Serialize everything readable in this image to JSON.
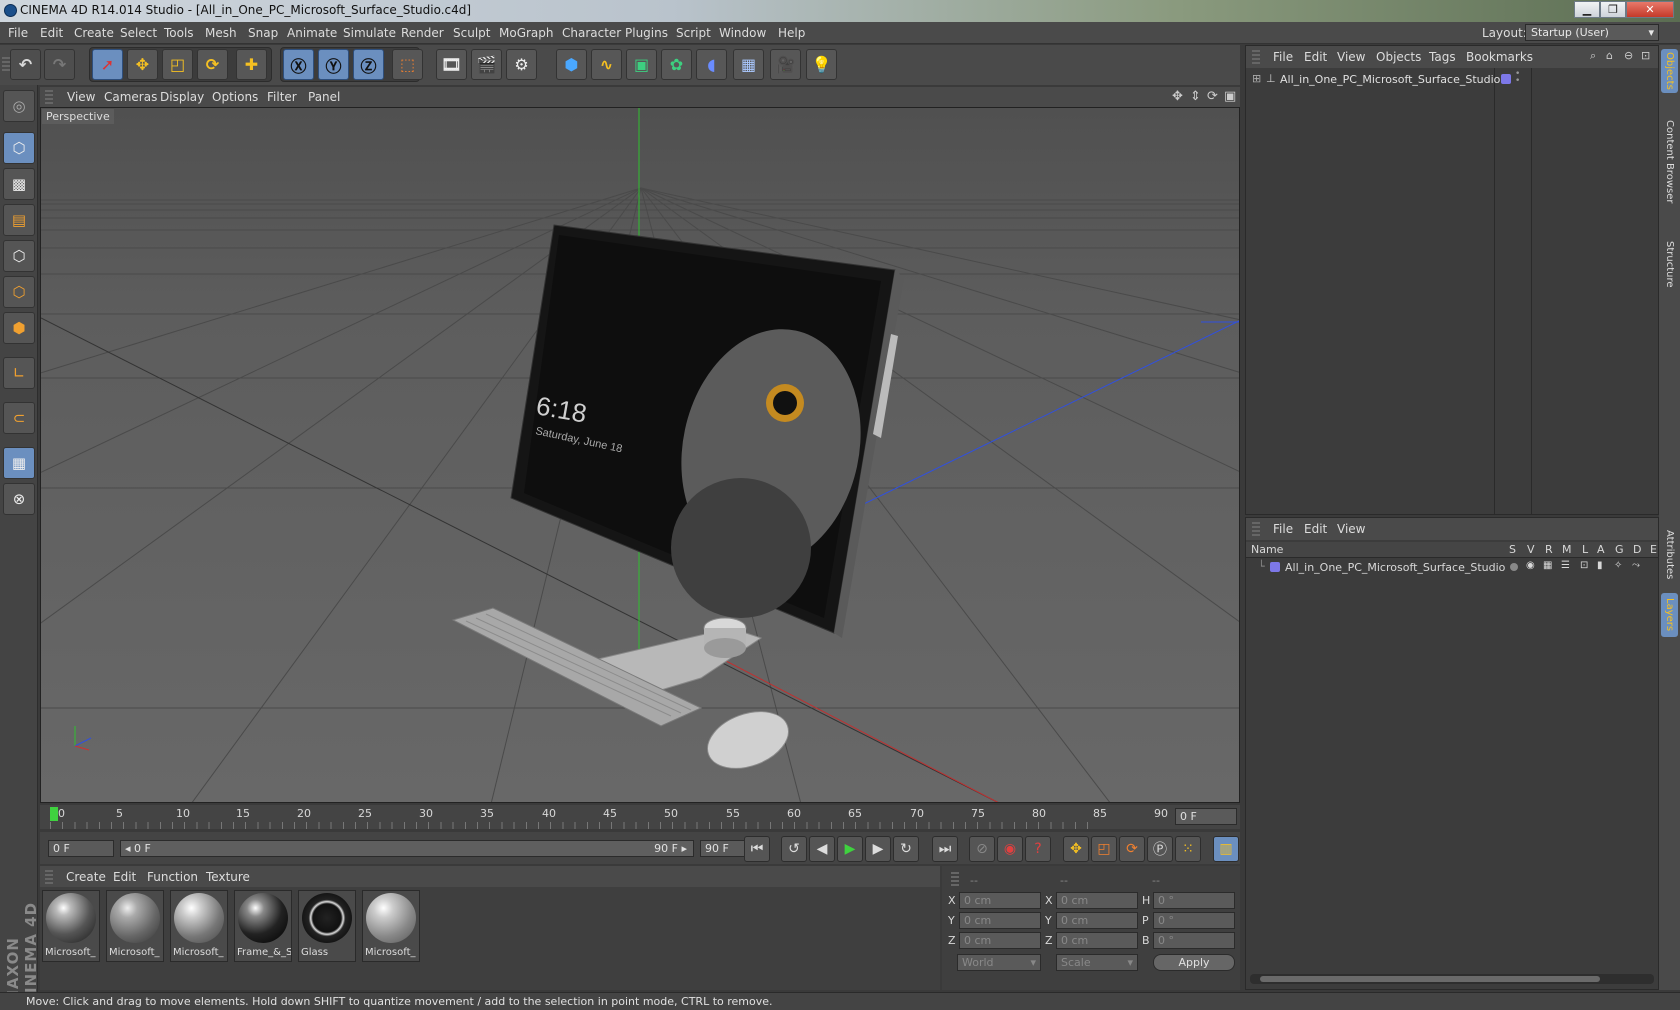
{
  "window": {
    "title": "CINEMA 4D R14.014 Studio - [All_in_One_PC_Microsoft_Surface_Studio.c4d]"
  },
  "menu": [
    "File",
    "Edit",
    "Create",
    "Select",
    "Tools",
    "Mesh",
    "Snap",
    "Animate",
    "Simulate",
    "Render",
    "Sculpt",
    "MoGraph",
    "Character",
    "Plugins",
    "Script",
    "Window",
    "Help"
  ],
  "layout": {
    "label": "Layout:",
    "value": "Startup (User)"
  },
  "toolbar_icons": [
    "undo-icon",
    "redo-icon",
    "live-selection-icon",
    "move-icon",
    "scale-icon",
    "rotate-icon",
    "add-icon",
    "x-axis-icon",
    "y-axis-icon",
    "z-axis-icon",
    "coordinate-system-icon",
    "render-view-icon",
    "render-picture-viewer-icon",
    "edit-render-settings-icon",
    "cube-icon",
    "spline-pen-icon",
    "subdivision-surface-icon",
    "array-icon",
    "deformer-icon",
    "floor-icon",
    "camera-icon",
    "light-icon"
  ],
  "viewport": {
    "menu": [
      "View",
      "Cameras",
      "Display",
      "Options",
      "Filter",
      "Panel"
    ],
    "label": "Perspective",
    "screen_time": "6:18",
    "screen_date": "Saturday, June 18"
  },
  "timeline": {
    "ticks": [
      "0",
      "5",
      "10",
      "15",
      "20",
      "25",
      "30",
      "35",
      "40",
      "45",
      "50",
      "55",
      "60",
      "65",
      "70",
      "75",
      "80",
      "85",
      "90"
    ],
    "end_frame": "0 F"
  },
  "transport": {
    "start": "0 F",
    "range_left": "◂ 0 F",
    "range_right": "90 F ▸",
    "end": "90 F"
  },
  "materials": {
    "menu": [
      "Create",
      "Edit",
      "Function",
      "Texture"
    ],
    "items": [
      "Microsoft_",
      "Microsoft_",
      "Microsoft_",
      "Frame_&_S",
      "Glass",
      "Microsoft_"
    ]
  },
  "coordinates": {
    "headers": [
      "--",
      "--",
      "--"
    ],
    "rows": [
      {
        "a": "X",
        "av": "0 cm",
        "b": "X",
        "bv": "0 cm",
        "c": "H",
        "cv": "0 °"
      },
      {
        "a": "Y",
        "av": "0 cm",
        "b": "Y",
        "bv": "0 cm",
        "c": "P",
        "cv": "0 °"
      },
      {
        "a": "Z",
        "av": "0 cm",
        "b": "Z",
        "bv": "0 cm",
        "c": "B",
        "cv": "0 °"
      }
    ],
    "mode1": "World",
    "mode2": "Scale",
    "apply": "Apply"
  },
  "object_manager": {
    "menu": [
      "File",
      "Edit",
      "View",
      "Objects",
      "Tags",
      "Bookmarks"
    ],
    "object": "All_in_One_PC_Microsoft_Surface_Studio"
  },
  "layer_manager": {
    "menu": [
      "File",
      "Edit",
      "View"
    ],
    "name_col": "Name",
    "cols": [
      "S",
      "V",
      "R",
      "M",
      "L",
      "A",
      "G",
      "D",
      "E"
    ],
    "layer": "All_in_One_PC_Microsoft_Surface_Studio"
  },
  "right_tabs": [
    "Objects",
    "Content Browser",
    "Structure",
    "Attributes",
    "Layers"
  ],
  "branding": "MAXON CINEMA 4D",
  "status": "Move: Click and drag to move elements. Hold down SHIFT to quantize movement / add to the selection in point mode, CTRL to remove.",
  "colors": {
    "accent": "#6b8fbf",
    "play": "#3fd23f",
    "x_axis": "#d03030",
    "y_axis": "#2fc02f",
    "z_axis": "#3050e0"
  }
}
